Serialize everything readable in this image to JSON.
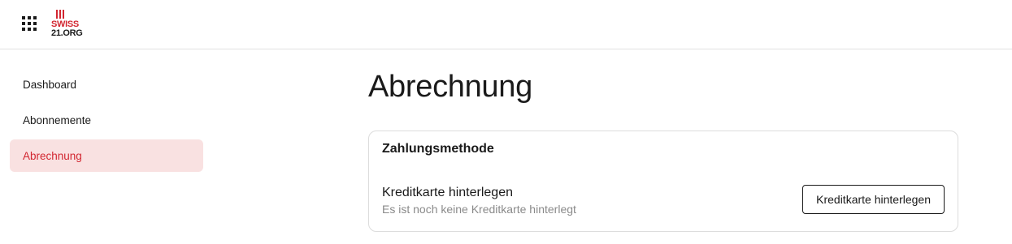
{
  "header": {
    "apps_icon": "grid-dots-icon",
    "logo": {
      "line1": "SWISS",
      "line2": "21.ORG",
      "accent_color": "#d22630"
    }
  },
  "sidebar": {
    "items": [
      {
        "label": "Dashboard",
        "active": false
      },
      {
        "label": "Abonnemente",
        "active": false
      },
      {
        "label": "Abrechnung",
        "active": true
      }
    ],
    "active_bg": "#f9e1e1",
    "active_color": "#d22630"
  },
  "main": {
    "title": "Abrechnung",
    "payment_card": {
      "title": "Zahlungsmethode",
      "row_title": "Kreditkarte hinterlegen",
      "row_subtitle": "Es ist noch keine Kreditkarte hinterlegt",
      "button_label": "Kreditkarte hinterlegen"
    }
  }
}
